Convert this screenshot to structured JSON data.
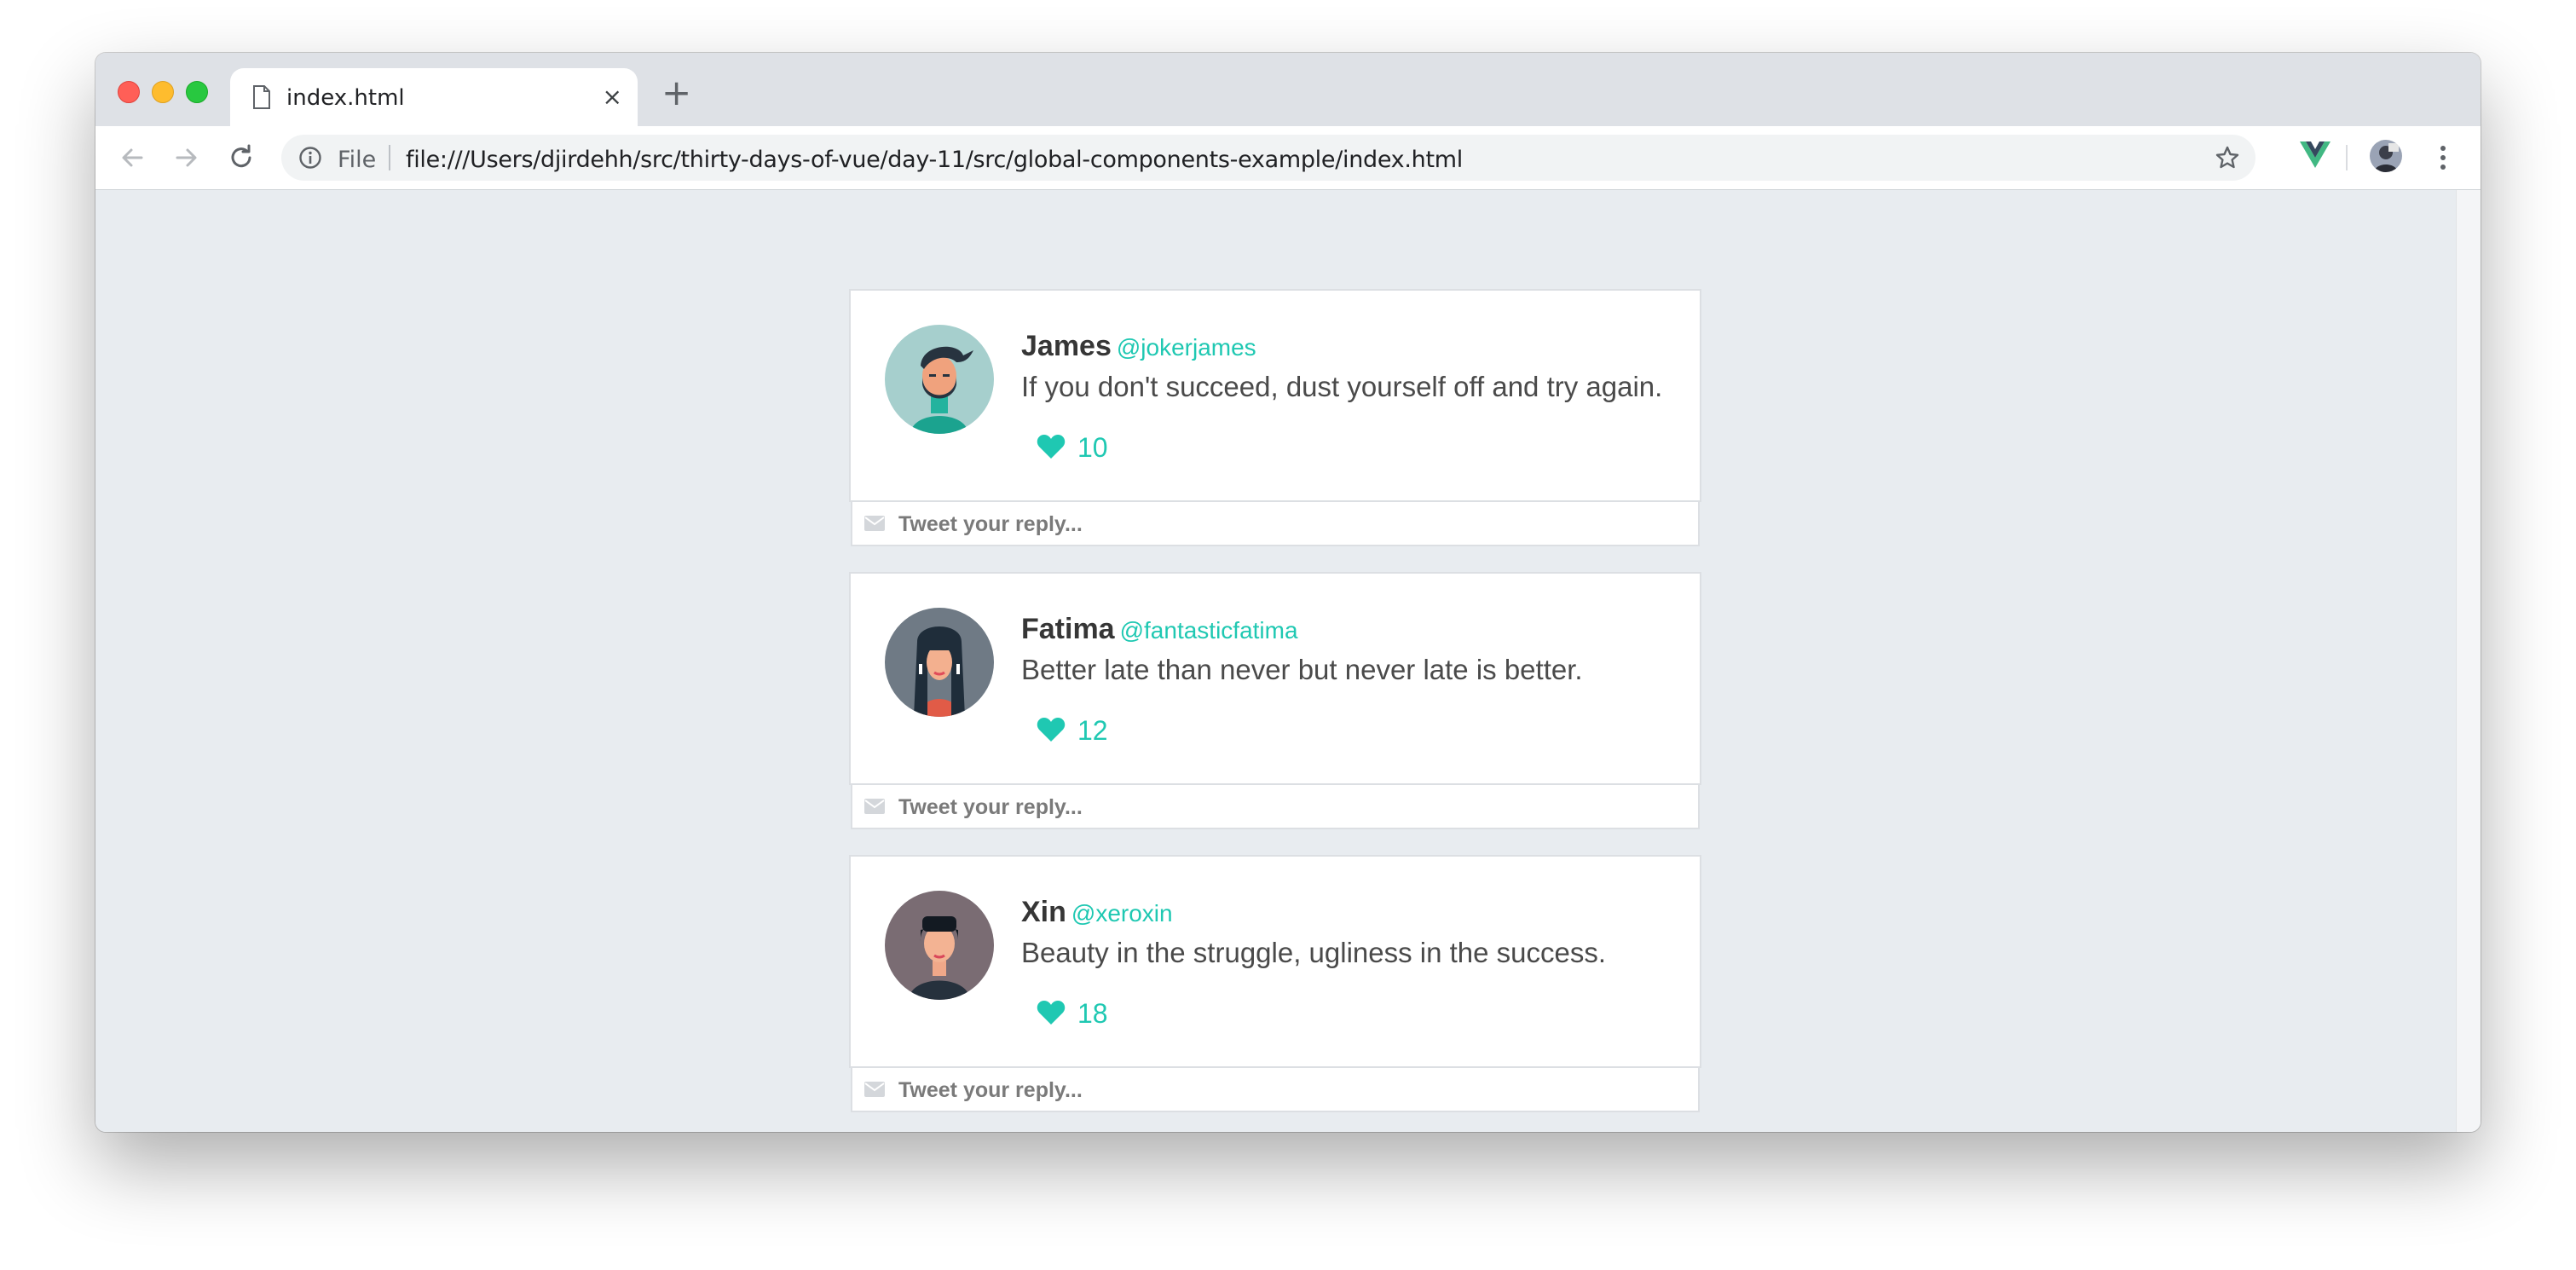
{
  "browser": {
    "tab_title": "index.html",
    "tab_close": "×",
    "new_tab": "+",
    "omnibox_scheme_label": "File",
    "url": "file:///Users/djirdehh/src/thirty-days-of-vue/day-11/src/global-components-example/index.html"
  },
  "colors": {
    "accent": "#1fc8b2",
    "page_background": "#e8ecf0",
    "card_background": "#ffffff"
  },
  "tweets": [
    {
      "name": "James",
      "handle": "@jokerjames",
      "text": "If you don't succeed, dust yourself off and try again.",
      "likes": "10",
      "reply_placeholder": "Tweet your reply...",
      "avatar_icon": "bearded-man-avatar"
    },
    {
      "name": "Fatima",
      "handle": "@fantasticfatima",
      "text": "Better late than never but never late is better.",
      "likes": "12",
      "reply_placeholder": "Tweet your reply...",
      "avatar_icon": "long-haired-woman-avatar"
    },
    {
      "name": "Xin",
      "handle": "@xeroxin",
      "text": "Beauty in the struggle, ugliness in the success.",
      "likes": "18",
      "reply_placeholder": "Tweet your reply...",
      "avatar_icon": "short-haired-woman-avatar"
    }
  ]
}
